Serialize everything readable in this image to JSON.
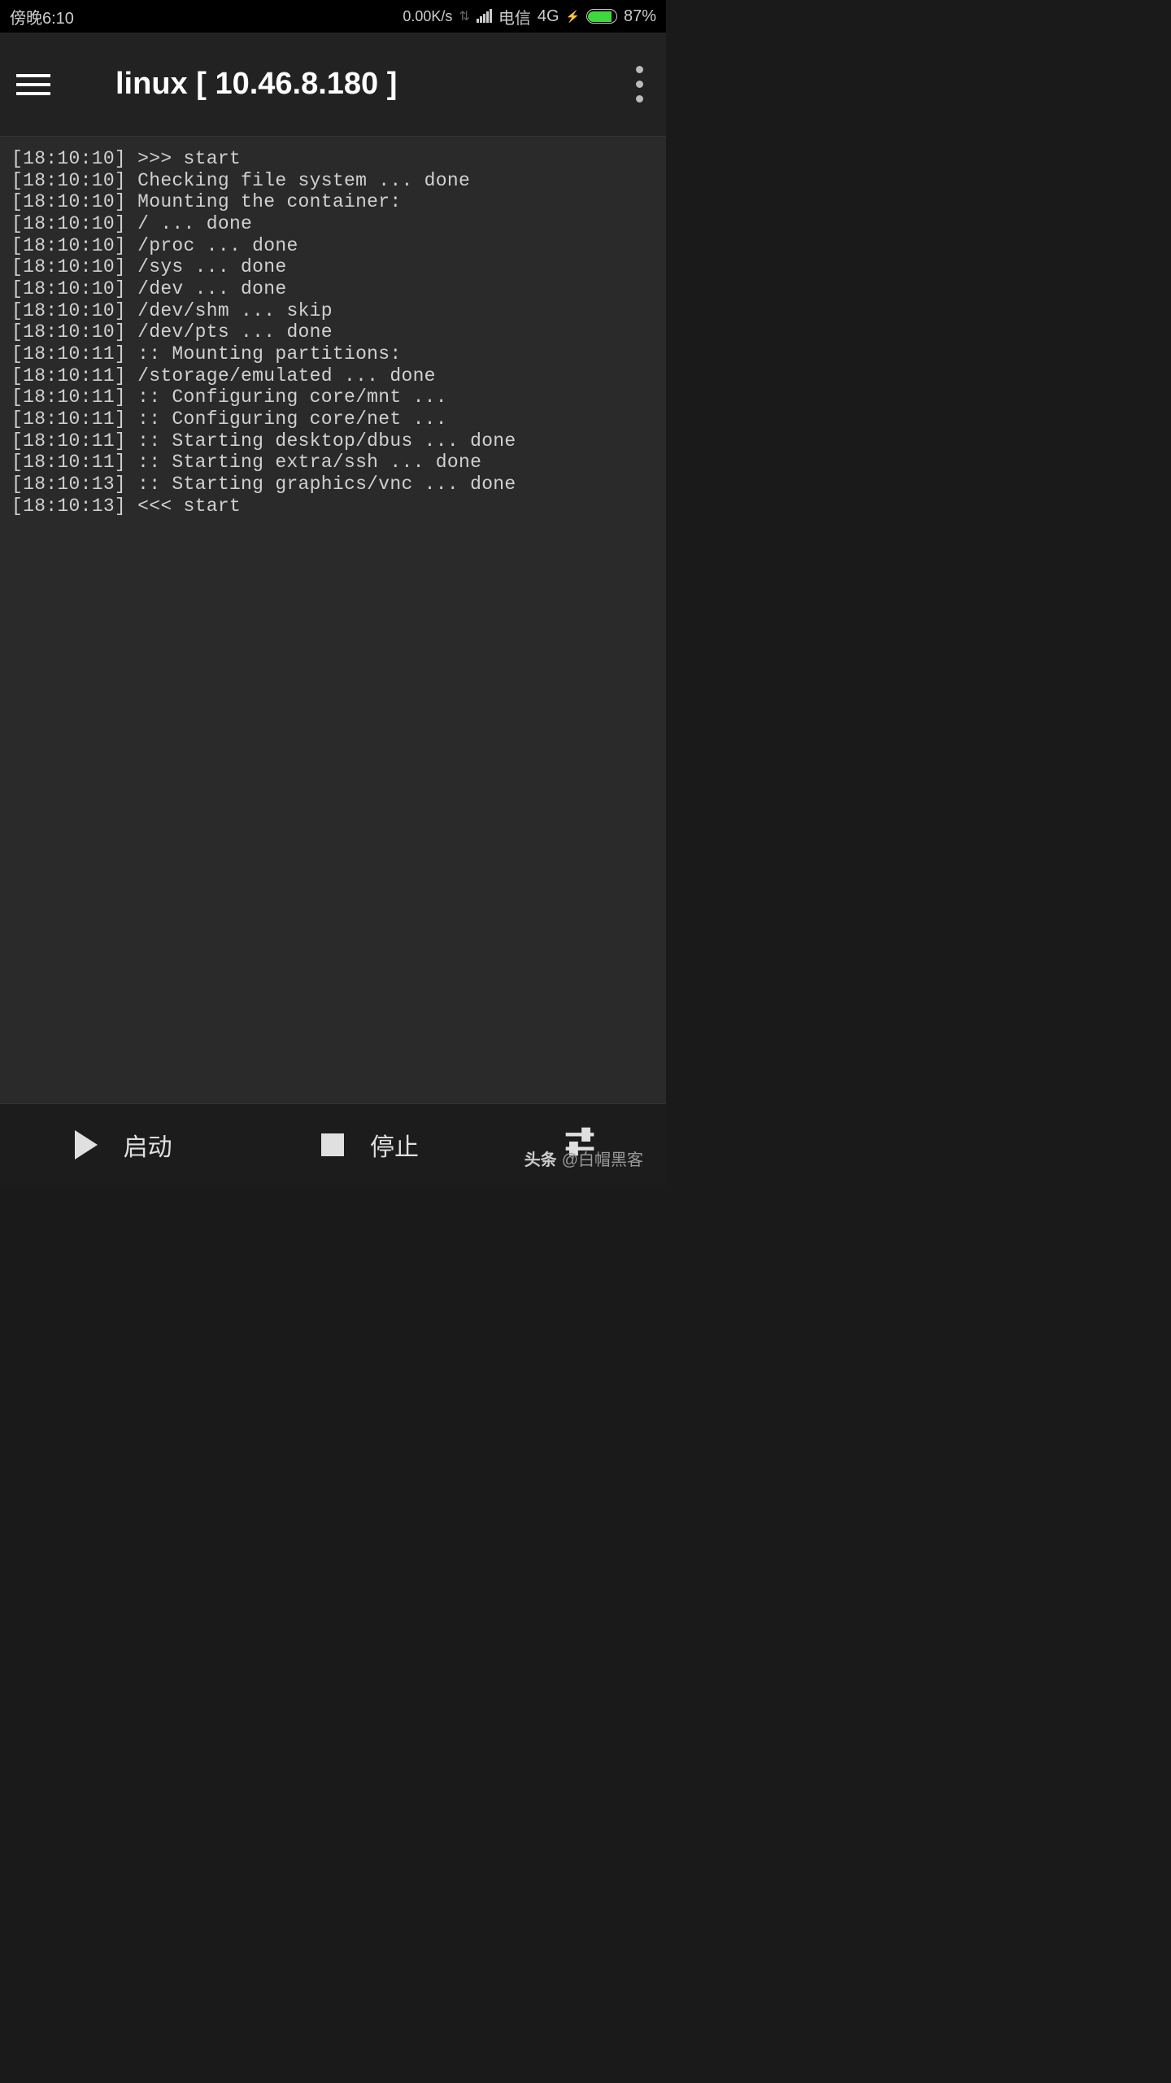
{
  "statusBar": {
    "time": "傍晚6:10",
    "netSpeed": "0.00K/s",
    "carrier": "电信",
    "network": "4G",
    "battery": "87%"
  },
  "appBar": {
    "title": "linux  [ 10.46.8.180 ]"
  },
  "terminal": {
    "lines": [
      "[18:10:10] >>> start",
      "[18:10:10] Checking file system ... done",
      "[18:10:10] Mounting the container: ",
      "[18:10:10] / ... done",
      "[18:10:10] /proc ... done",
      "[18:10:10] /sys ... done",
      "[18:10:10] /dev ... done",
      "[18:10:10] /dev/shm ... skip",
      "[18:10:10] /dev/pts ... done",
      "[18:10:11] :: Mounting partitions: ",
      "[18:10:11] /storage/emulated ... done",
      "[18:10:11] :: Configuring core/mnt ... ",
      "[18:10:11] :: Configuring core/net ... ",
      "[18:10:11] :: Starting desktop/dbus ... done",
      "[18:10:11] :: Starting extra/ssh ... done",
      "[18:10:13] :: Starting graphics/vnc ... done",
      "[18:10:13] <<< start"
    ]
  },
  "bottomBar": {
    "start": "启动",
    "stop": "停止"
  },
  "watermark": {
    "brand": "头条",
    "author": "@白帽黑客"
  }
}
